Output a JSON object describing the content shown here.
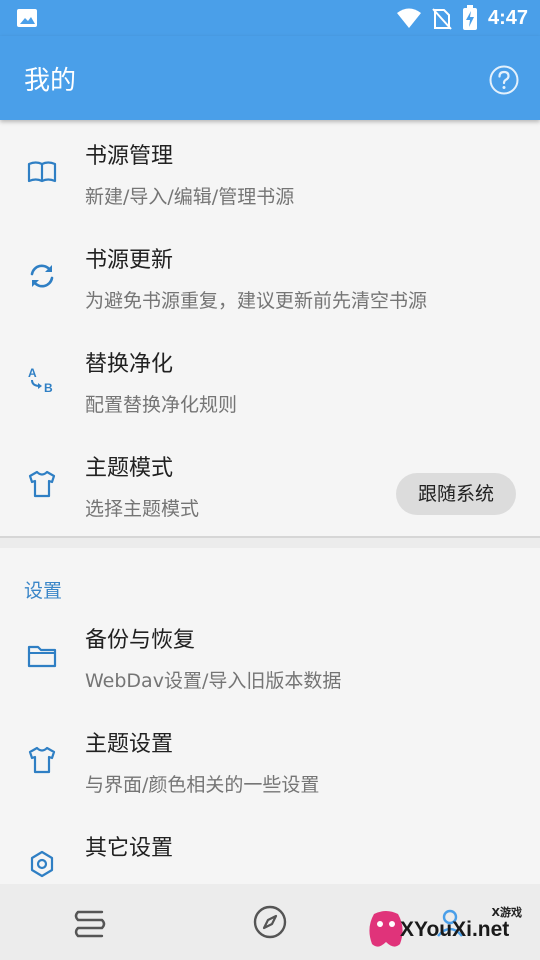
{
  "status_bar": {
    "time": "4:47"
  },
  "app_bar": {
    "title": "我的",
    "help_icon": "help-circle-icon"
  },
  "items": [
    {
      "title": "书源管理",
      "subtitle": "新建/导入/编辑/管理书源",
      "icon": "book-open-icon"
    },
    {
      "title": "书源更新",
      "subtitle": "为避免书源重复，建议更新前先清空书源",
      "icon": "sync-icon"
    },
    {
      "title": "替换净化",
      "subtitle": "配置替换净化规则",
      "icon": "replace-ab-icon"
    },
    {
      "title": "主题模式",
      "subtitle": "选择主题模式",
      "icon": "tshirt-icon",
      "pill": "跟随系统"
    }
  ],
  "settings_section": {
    "label": "设置",
    "items": [
      {
        "title": "备份与恢复",
        "subtitle": "WebDav设置/导入旧版本数据",
        "icon": "folder-icon"
      },
      {
        "title": "主题设置",
        "subtitle": "与界面/颜色相关的一些设置",
        "icon": "tshirt-icon"
      },
      {
        "title": "其它设置",
        "subtitle": "",
        "icon": "hexagon-settings-icon"
      }
    ]
  },
  "bottom_nav": {
    "items": [
      "bookshelf-icon",
      "compass-icon",
      "my-icon"
    ]
  },
  "watermark": {
    "text": "XYouXi.net",
    "sup": "X游戏"
  },
  "colors": {
    "accent": "#4a9fe9",
    "section": "#3a86c8",
    "icon": "#2f7fc4"
  }
}
